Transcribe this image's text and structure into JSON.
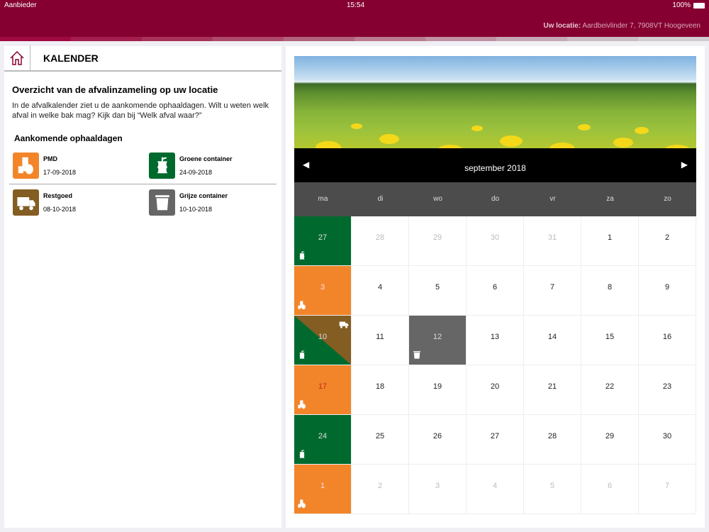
{
  "status": {
    "carrier": "Aanbieder",
    "time": "15:54",
    "battery": "100%"
  },
  "header": {
    "location_label": "Uw locatie:",
    "location_value": "Aardbeivlinder 7, 7908VT Hoogeveen"
  },
  "colors": {
    "brand": "#850030",
    "pmd": "#f2852a",
    "groen": "#006a2e",
    "rest": "#835d22",
    "grijs": "#666666"
  },
  "left": {
    "title": "KALENDER",
    "heading": "Overzicht van de afvalinzameling op uw locatie",
    "intro": "In de afvalkalender ziet u de aankomende ophaaldagen. Wilt u weten welk afval in welke bak mag? Kijk dan bij “Welk afval waar?”",
    "upcoming_title": "Aankomende ophaaldagen",
    "upcoming": [
      {
        "name": "PMD",
        "date": "17-09-2018",
        "type": "o"
      },
      {
        "name": "Groene container",
        "date": "24-09-2018",
        "type": "g"
      },
      {
        "name": "Restgoed",
        "date": "08-10-2018",
        "type": "rest"
      },
      {
        "name": "Grijze container",
        "date": "10-10-2018",
        "type": "r"
      }
    ]
  },
  "calendar": {
    "month": "september 2018",
    "prev": "◀",
    "next": "▶",
    "weekdays": [
      "ma",
      "di",
      "wo",
      "do",
      "vr",
      "za",
      "zo"
    ],
    "days": [
      {
        "d": "27",
        "t": "g"
      },
      {
        "d": "28",
        "m": 1
      },
      {
        "d": "29",
        "m": 1
      },
      {
        "d": "30",
        "m": 1
      },
      {
        "d": "31",
        "m": 1
      },
      {
        "d": "1"
      },
      {
        "d": "2"
      },
      {
        "d": "3",
        "t": "o"
      },
      {
        "d": "4"
      },
      {
        "d": "5"
      },
      {
        "d": "6"
      },
      {
        "d": "7"
      },
      {
        "d": "8"
      },
      {
        "d": "9"
      },
      {
        "d": "10",
        "t": "split"
      },
      {
        "d": "11"
      },
      {
        "d": "12",
        "t": "r"
      },
      {
        "d": "13"
      },
      {
        "d": "14"
      },
      {
        "d": "15"
      },
      {
        "d": "16"
      },
      {
        "d": "17",
        "t": "o",
        "red": 1
      },
      {
        "d": "18"
      },
      {
        "d": "19"
      },
      {
        "d": "20"
      },
      {
        "d": "21"
      },
      {
        "d": "22"
      },
      {
        "d": "23"
      },
      {
        "d": "24",
        "t": "g"
      },
      {
        "d": "25"
      },
      {
        "d": "26"
      },
      {
        "d": "27"
      },
      {
        "d": "28"
      },
      {
        "d": "29"
      },
      {
        "d": "30"
      },
      {
        "d": "1",
        "t": "o"
      },
      {
        "d": "2",
        "m": 1
      },
      {
        "d": "3",
        "m": 1
      },
      {
        "d": "4",
        "m": 1
      },
      {
        "d": "5",
        "m": 1
      },
      {
        "d": "6",
        "m": 1
      },
      {
        "d": "7",
        "m": 1
      }
    ]
  }
}
